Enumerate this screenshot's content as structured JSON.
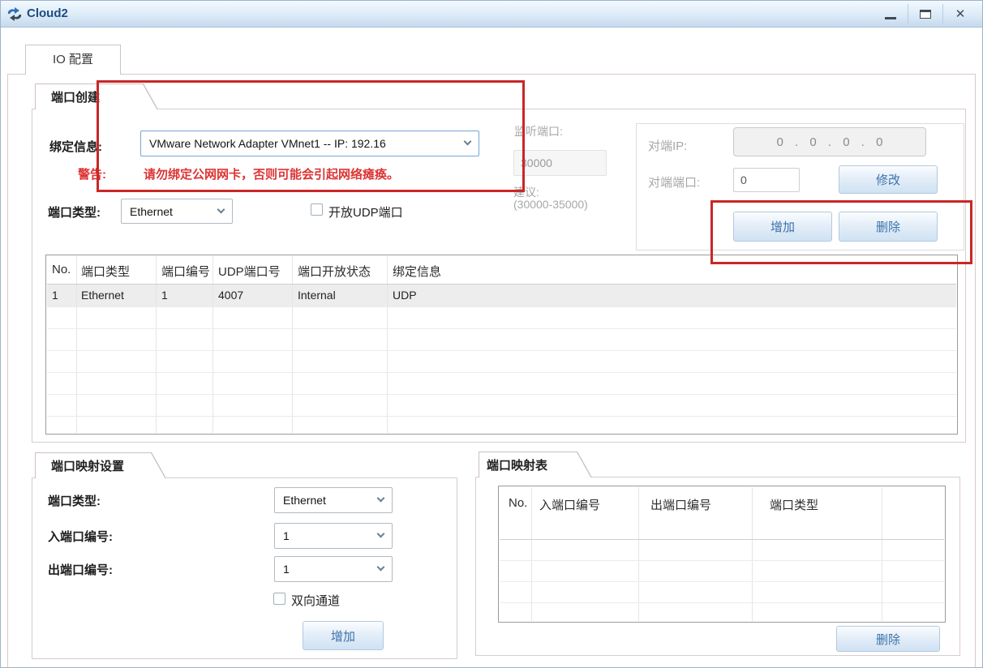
{
  "window": {
    "title": "Cloud2"
  },
  "icons": {
    "close_glyph": "✕"
  },
  "tab": {
    "label": "IO 配置"
  },
  "port_create": {
    "title": "端口创建",
    "binding_label": "绑定信息:",
    "binding_value": "VMware Network Adapter VMnet1 -- IP: 192.16",
    "warning_label": "警告:",
    "warning_text": "请勿绑定公网网卡，否则可能会引起网络瘫痪。",
    "port_type_label": "端口类型:",
    "port_type_value": "Ethernet",
    "udp_checkbox_label": "开放UDP端口",
    "listen_port_label": "监听端口:",
    "listen_port_value": "30000",
    "suggest_label": "建议:",
    "suggest_range": "(30000-35000)",
    "peer_ip_label": "对端IP:",
    "peer_ip_value": "0 . 0 . 0 . 0",
    "peer_port_label": "对端端口:",
    "peer_port_value": "0",
    "modify_button": "修改",
    "add_button": "增加",
    "delete_button": "删除",
    "table": {
      "headers": [
        "No.",
        "端口类型",
        "端口编号",
        "UDP端口号",
        "端口开放状态",
        "绑定信息"
      ],
      "rows": [
        [
          "1",
          "Ethernet",
          "1",
          "4007",
          "Internal",
          "UDP"
        ]
      ]
    }
  },
  "port_mapping_settings": {
    "title": "端口映射设置",
    "port_type_label": "端口类型:",
    "port_type_value": "Ethernet",
    "in_port_label": "入端口编号:",
    "in_port_value": "1",
    "out_port_label": "出端口编号:",
    "out_port_value": "1",
    "bidir_checkbox_label": "双向通道",
    "add_button": "增加"
  },
  "port_mapping_table": {
    "title": "端口映射表",
    "headers": [
      "No.",
      "入端口编号",
      "出端口编号",
      "端口类型"
    ],
    "rows": [],
    "delete_button": "删除"
  },
  "colors": {
    "annotation_red": "#c92727",
    "warning_red": "#dd3434",
    "button_text_blue": "#3c72aa",
    "title_blue": "#1d4b82"
  }
}
